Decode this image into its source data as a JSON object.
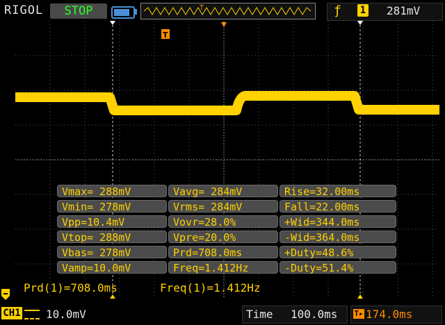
{
  "topbar": {
    "brand": "RIGOL",
    "run_status": "STOP",
    "trigger_channel": "1",
    "trigger_level": "281mV"
  },
  "measurements": [
    [
      "Vmax= 288mV",
      "Vavg= 284mV",
      "Rise=32.00ms"
    ],
    [
      "Vmin= 278mV",
      "Vrms= 284mV",
      "Fall=22.00ms"
    ],
    [
      "Vpp=10.4mV",
      "Vovr=28.0%",
      "+Wid=344.0ms"
    ],
    [
      "Vtop= 288mV",
      "Vpre=20.0%",
      "-Wid=364.0ms"
    ],
    [
      "Vbas= 278mV",
      "Prd=708.0ms",
      "+Duty=48.6%"
    ],
    [
      "Vamp=10.0mV",
      "Freq=1.412Hz",
      "-Duty=51.4%"
    ]
  ],
  "cursor_readout": {
    "period": "Prd(1)=708.0ms",
    "frequency": "Freq(1)=1.412Hz"
  },
  "bottombar": {
    "channel_label": "CH1",
    "vertical_scale": "10.0mV",
    "time_label": "Time",
    "timebase": "100.0ms",
    "trigger_offset": "174.0ms"
  },
  "colors": {
    "trace": "#ffd200",
    "grid": "#7a7a7a",
    "trigger_marker": "#ff8c00",
    "status": "#2bff2b"
  }
}
